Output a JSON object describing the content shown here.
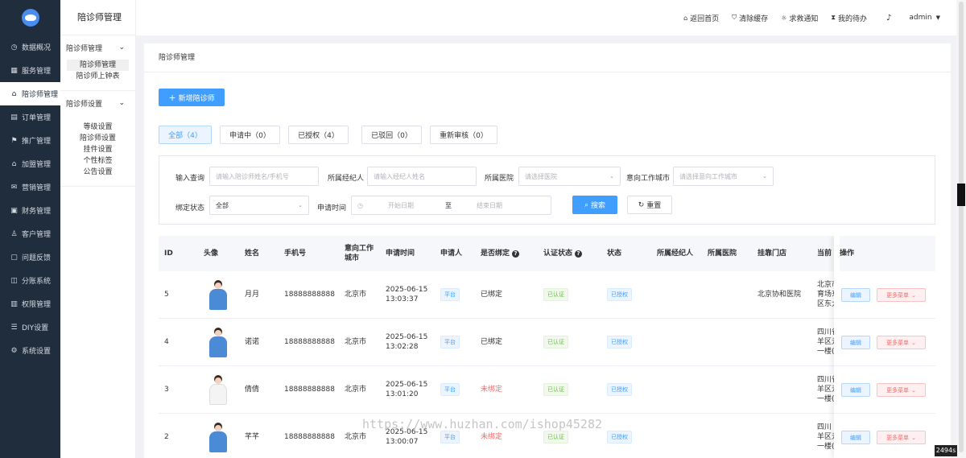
{
  "nav": {
    "items": [
      {
        "label": "数据概况",
        "icon": "clock-icon",
        "glyph": "◷",
        "active": false
      },
      {
        "label": "服务管理",
        "icon": "grid-icon",
        "glyph": "▦",
        "active": false
      },
      {
        "label": "陪诊师管理",
        "icon": "home-icon",
        "glyph": "⌂",
        "active": true
      },
      {
        "label": "订单管理",
        "icon": "clipboard-icon",
        "glyph": "▤",
        "active": false
      },
      {
        "label": "推广管理",
        "icon": "share-icon",
        "glyph": "⚑",
        "active": false
      },
      {
        "label": "加盟管理",
        "icon": "home-icon",
        "glyph": "⌂",
        "active": false
      },
      {
        "label": "营销管理",
        "icon": "gift-icon",
        "glyph": "✉",
        "active": false
      },
      {
        "label": "财务管理",
        "icon": "wallet-icon",
        "glyph": "▣",
        "active": false
      },
      {
        "label": "客户管理",
        "icon": "user-icon",
        "glyph": "♙",
        "active": false
      },
      {
        "label": "问题反馈",
        "icon": "feedback-icon",
        "glyph": "▢",
        "active": false
      },
      {
        "label": "分账系统",
        "icon": "split-icon",
        "glyph": "◫",
        "active": false
      },
      {
        "label": "权限管理",
        "icon": "lock-icon",
        "glyph": "▥",
        "active": false
      },
      {
        "label": "DIY设置",
        "icon": "diy-icon",
        "glyph": "☰",
        "active": false
      },
      {
        "label": "系统设置",
        "icon": "gear-icon",
        "glyph": "⚙",
        "active": false
      }
    ]
  },
  "subnav": {
    "title": "陪诊师管理",
    "groups": [
      {
        "label": "陪诊师管理",
        "items": [
          {
            "label": "陪诊师管理",
            "active": true
          },
          {
            "label": "陪诊师上钟表",
            "active": false
          }
        ]
      },
      {
        "label": "陪诊师设置",
        "items": [
          {
            "label": "等级设置",
            "active": false
          },
          {
            "label": "陪诊师设置",
            "active": false
          },
          {
            "label": "挂件设置",
            "active": false
          },
          {
            "label": "个性标签",
            "active": false
          },
          {
            "label": "公告设置",
            "active": false
          }
        ]
      }
    ]
  },
  "topbar": {
    "home": "返回首页",
    "clear_cache": "清除缓存",
    "help": "求救通知",
    "todo": "我的待办",
    "user": "admin"
  },
  "page": {
    "breadcrumb": "陪诊师管理",
    "add_button": "新增陪诊师",
    "tabs": [
      "全部（4）",
      "申请中（0）",
      "已授权（4）",
      "已驳回（0）",
      "重新审核（0）"
    ]
  },
  "filters": {
    "keyword_label": "输入查询",
    "keyword_placeholder": "请输入陪诊师姓名/手机号",
    "agent_label": "所属经纪人",
    "agent_placeholder": "请输入经纪人姓名",
    "hospital_label": "所属医院",
    "hospital_placeholder": "请选择医院",
    "city_label": "意向工作城市",
    "city_placeholder": "请选择意向工作城市",
    "bind_label": "绑定状态",
    "bind_value": "全部",
    "time_label": "申请时间",
    "start_placeholder": "开始日期",
    "to": "至",
    "end_placeholder": "结束日期",
    "search": "搜索",
    "reset": "重置"
  },
  "table": {
    "headers": {
      "id": "ID",
      "avatar": "头像",
      "name": "姓名",
      "phone": "手机号",
      "city1": "意向工作",
      "city2": "城市",
      "time": "申请时间",
      "applicant": "申请人",
      "bound": "是否绑定",
      "auth": "认证状态",
      "status": "状态",
      "agent": "所属经纪人",
      "hospital": "所属医院",
      "store": "挂靠门店",
      "addr": "当前",
      "ops": "操作"
    },
    "rows": [
      {
        "id": "5",
        "name": "月月",
        "phone": "18888888888",
        "city": "北京市",
        "date": "2025-06-15",
        "time": "13:03:37",
        "applicant": "平台",
        "bound": "已绑定",
        "bound_red": false,
        "auth": "已认证",
        "status": "已授权",
        "store": "北京协和医院",
        "addr": [
          "北京市",
          "育场东",
          "区东大"
        ],
        "avatar": "blue"
      },
      {
        "id": "4",
        "name": "诺诺",
        "phone": "18888888888",
        "city": "北京市",
        "date": "2025-06-15",
        "time": "13:02:28",
        "applicant": "平台",
        "bound": "已绑定",
        "bound_red": false,
        "auth": "已认证",
        "status": "已授权",
        "store": "",
        "addr": [
          "四川省",
          "羊区元",
          "一楼("
        ],
        "avatar": "blue"
      },
      {
        "id": "3",
        "name": "倩倩",
        "phone": "18888888888",
        "city": "北京市",
        "date": "2025-06-15",
        "time": "13:01:20",
        "applicant": "平台",
        "bound": "未绑定",
        "bound_red": true,
        "auth": "已认证",
        "status": "已授权",
        "store": "",
        "addr": [
          "四川省",
          "羊区元",
          "一楼("
        ],
        "avatar": "white"
      },
      {
        "id": "2",
        "name": "芊芊",
        "phone": "18888888888",
        "city": "北京市",
        "date": "2025-06-15",
        "time": "13:00:07",
        "applicant": "平台",
        "bound": "未绑定",
        "bound_red": true,
        "auth": "已认证",
        "status": "已授权",
        "store": "",
        "addr": [
          "四川",
          "羊区元",
          "一楼("
        ],
        "avatar": "blue"
      }
    ],
    "edit": "编辑",
    "more": "更多菜单"
  },
  "watermark": "https://www.huzhan.com/ishop45282",
  "fps": "2494s"
}
